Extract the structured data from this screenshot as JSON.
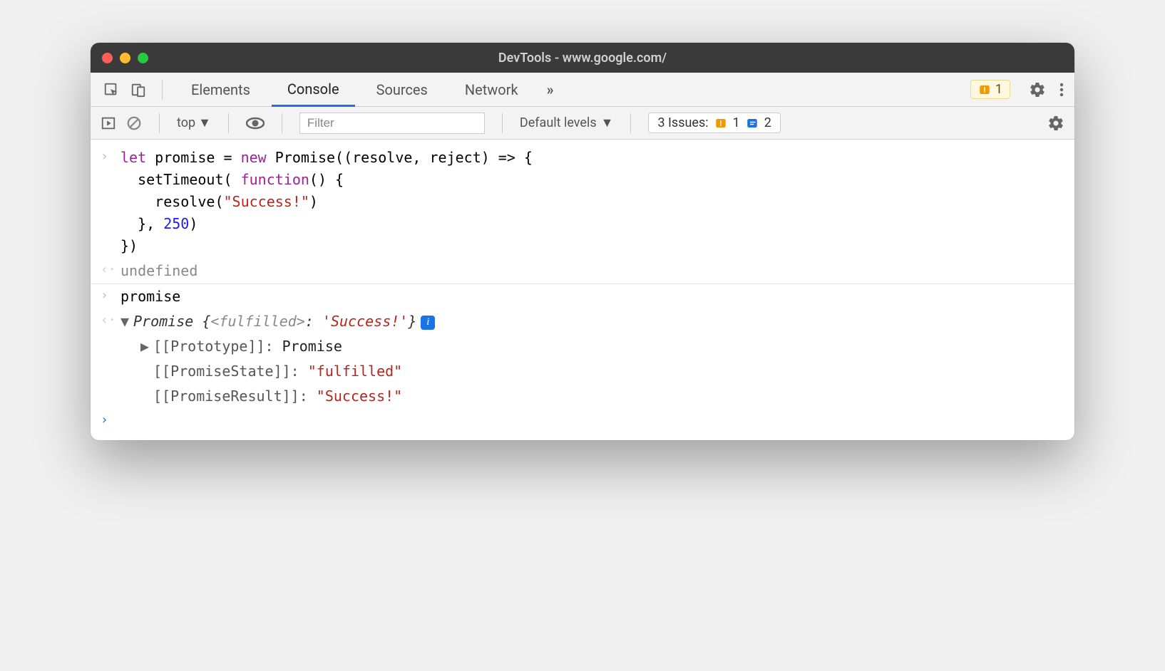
{
  "window": {
    "title": "DevTools - www.google.com/"
  },
  "tabs": {
    "items": [
      "Elements",
      "Console",
      "Sources",
      "Network"
    ],
    "active_index": 1,
    "overflow_glyph": "»",
    "warning_count": "1"
  },
  "toolbar": {
    "context_label": "top",
    "filter_placeholder": "Filter",
    "levels_label": "Default levels",
    "issues_label": "3 Issues:",
    "issues_warn_count": "1",
    "issues_info_count": "2"
  },
  "console": {
    "input1": {
      "line1_a": "let",
      "line1_b": " promise = ",
      "line1_c": "new",
      "line1_d": " Promise((resolve, reject) => {",
      "line2_a": "  setTimeout( ",
      "line2_b": "function",
      "line2_c": "() {",
      "line3_a": "    resolve(",
      "line3_b": "\"Success!\"",
      "line3_c": ")",
      "line4_a": "  }, ",
      "line4_b": "250",
      "line4_c": ")",
      "line5": "})"
    },
    "result1": "undefined",
    "input2": "promise",
    "object": {
      "summary_type": "Promise ",
      "summary_open": "{",
      "summary_state": "<fulfilled>",
      "summary_colon": ": ",
      "summary_value": "'Success!'",
      "summary_close": "}",
      "props": [
        {
          "expandable": true,
          "key": "[[Prototype]]",
          "value": "Promise",
          "is_string": false
        },
        {
          "expandable": false,
          "key": "[[PromiseState]]",
          "value": "\"fulfilled\"",
          "is_string": true
        },
        {
          "expandable": false,
          "key": "[[PromiseResult]]",
          "value": "\"Success!\"",
          "is_string": true
        }
      ]
    }
  }
}
